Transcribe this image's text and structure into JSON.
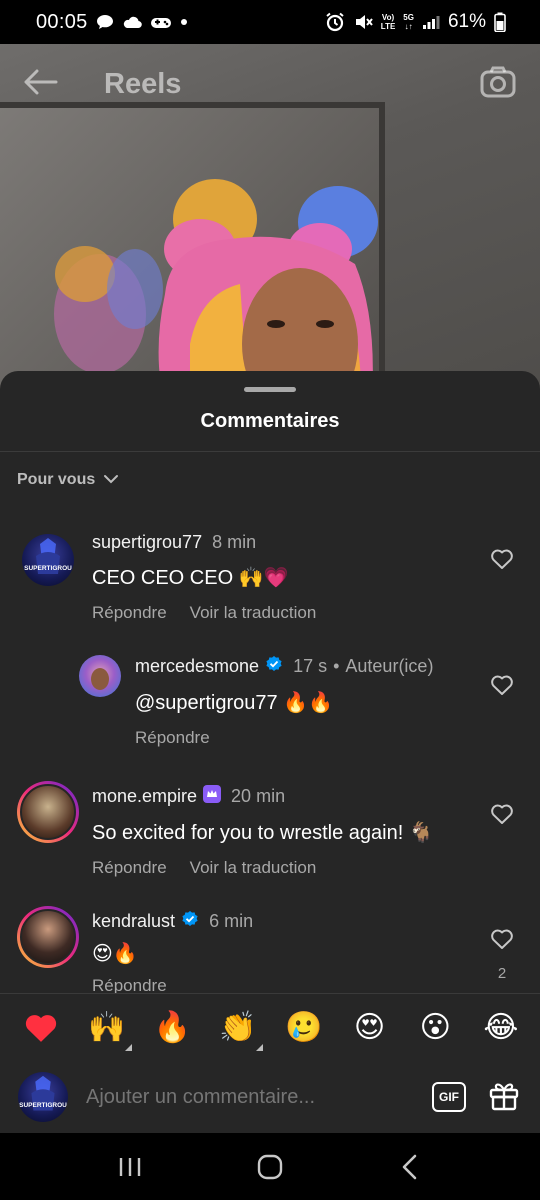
{
  "status_bar": {
    "time": "00:05",
    "network_top": "Vo)",
    "network_bottom": "LTE",
    "signal_top": "5G",
    "signal_bottom": "↓↑",
    "battery": "61%"
  },
  "header": {
    "title": "Reels"
  },
  "sheet": {
    "title": "Commentaires",
    "filter_label": "Pour vous"
  },
  "comments": [
    {
      "username": "supertigrou77",
      "time": "8 min",
      "text": "CEO CEO CEO 🙌💗",
      "reply_label": "Répondre",
      "translate_label": "Voir la traduction",
      "avatar_text": "SUPERTIGROU"
    },
    {
      "username": "mercedesmone",
      "verified": true,
      "time": "17 s",
      "author_label": "Auteur(ice)",
      "text": "@supertigrou77 🔥🔥",
      "reply_label": "Répondre"
    },
    {
      "username": "mone.empire",
      "crown_badge": true,
      "time": "20 min",
      "text": "So excited for you to wrestle again! 🐐",
      "reply_label": "Répondre",
      "translate_label": "Voir la traduction"
    },
    {
      "username": "kendralust",
      "verified": true,
      "time": "6 min",
      "text": "😍🔥",
      "reply_label": "Répondre",
      "like_count": "2"
    }
  ],
  "emoji_bar": {
    "emojis": [
      "❤️",
      "🙌",
      "🔥",
      "👏",
      "🥲",
      "😍",
      "😮",
      "😂"
    ]
  },
  "compose": {
    "placeholder": "Ajouter un commentaire...",
    "gif_label": "GIF",
    "avatar_text": "SUPERTIGROU"
  },
  "colors": {
    "sheet_bg": "#262626",
    "verified_blue": "#0095f6",
    "muted_text": "#a8a8a8",
    "crown_purple": "#8a5cf6"
  }
}
